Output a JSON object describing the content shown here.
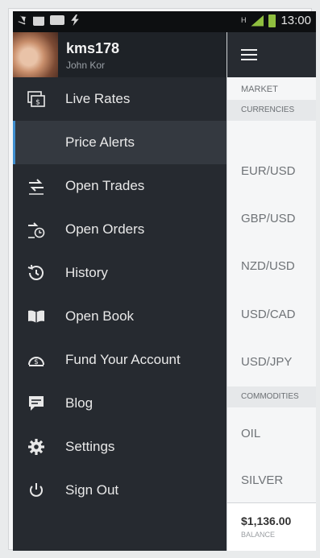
{
  "status_bar": {
    "network_type": "H",
    "time": "13:00"
  },
  "profile": {
    "username": "kms178",
    "full_name": "John Kor"
  },
  "menu": {
    "items": [
      {
        "label": "Live Rates",
        "icon": "live-rates-icon"
      },
      {
        "label": "Price Alerts",
        "icon": "",
        "active": true
      },
      {
        "label": "Open Trades",
        "icon": "open-trades-icon"
      },
      {
        "label": "Open Orders",
        "icon": "open-orders-icon"
      },
      {
        "label": "History",
        "icon": "history-icon"
      },
      {
        "label": "Open Book",
        "icon": "open-book-icon"
      },
      {
        "label": "Fund Your Account",
        "icon": "fund-account-icon"
      },
      {
        "label": "Blog",
        "icon": "blog-icon"
      },
      {
        "label": "Settings",
        "icon": "gear-icon"
      },
      {
        "label": "Sign Out",
        "icon": "power-icon"
      }
    ]
  },
  "content": {
    "market_label": "MARKET",
    "currencies_label": "CURRENCIES",
    "currency_pairs": [
      "EUR/USD",
      "GBP/USD",
      "NZD/USD",
      "USD/CAD",
      "USD/JPY"
    ],
    "commodities_label": "COMMODITIES",
    "commodities": [
      "OIL",
      "SILVER"
    ],
    "balance_value": "$1,136.00",
    "balance_label": "BALANCE"
  },
  "colors": {
    "drawer_bg": "#262a30",
    "active_item_bg": "#343940",
    "accent": "#3f8ecf",
    "battery_green": "#8fbf3f"
  }
}
